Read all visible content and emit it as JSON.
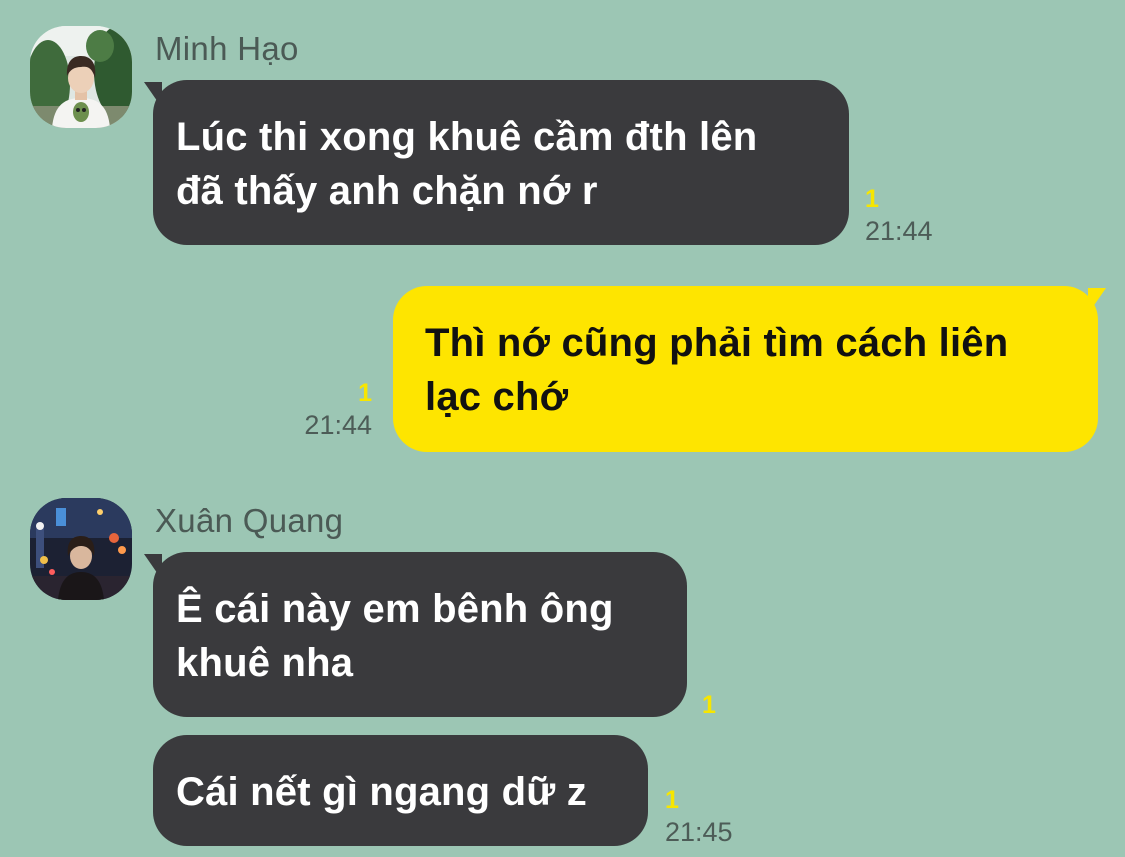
{
  "messages": [
    {
      "sender": "Minh Hạo",
      "text": "Lúc thi xong khuê cầm đth lên đã thấy anh chặn nớ r",
      "line1": "Lúc thi xong khuê cầm đth lên",
      "line2": "đã thấy anh chặn nớ r",
      "unread": "1",
      "time": "21:44"
    },
    {
      "sender": "",
      "line1": "Thì nớ cũng phải tìm cách liên",
      "line2": "lạc chớ",
      "unread": "1",
      "time": "21:44"
    },
    {
      "sender": "Xuân Quang",
      "line1": "Ê cái này em bênh ông",
      "line2": "khuê nha",
      "unread": "1",
      "time": ""
    },
    {
      "sender": "",
      "line1": "Cái nết gì ngang dữ z",
      "unread": "1",
      "time": "21:45"
    }
  ],
  "colors": {
    "background": "#9cc6b4",
    "incoming_bubble": "#3a3a3d",
    "outgoing_bubble": "#fee500",
    "unread_count": "#f7e600"
  }
}
